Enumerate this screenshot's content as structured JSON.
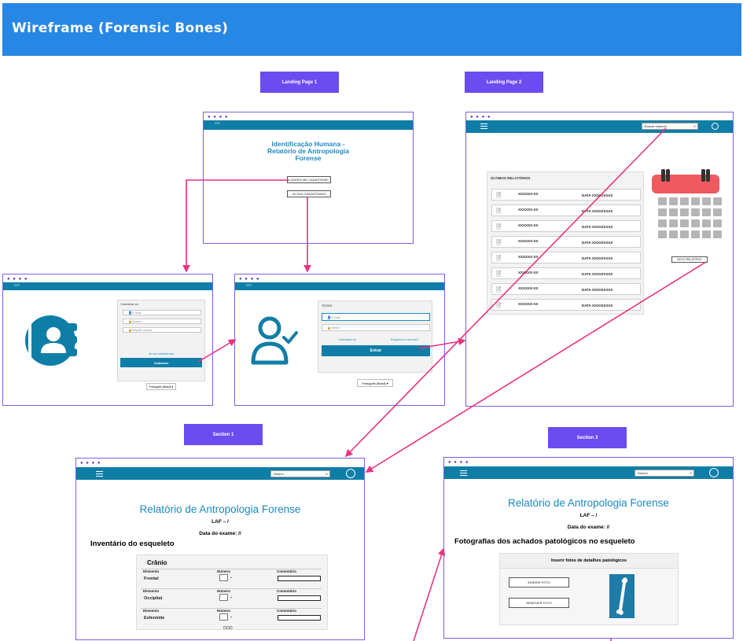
{
  "header": {
    "title": "Wireframe  (Forensic Bones)"
  },
  "tags": {
    "landing1": "Landing Page 1",
    "landing2": "Landing Page 2",
    "section1": "Section 1",
    "section3": "Section 3"
  },
  "landing1": {
    "bar_text": "≡≡≡",
    "title_lines": [
      "Identificação Humana -",
      "Relatório de Antropologia",
      "Forense"
    ],
    "btn_register": "QUERO ME CADASTRAR",
    "btn_login": "JÁ SOU CADASTRADO"
  },
  "register": {
    "bar_text": "≡≡≡",
    "panel_title": "Cadastrar-se",
    "fields": [
      "E-mail",
      "Senha",
      "Repetir senha"
    ],
    "link": "Já sou cadastrado",
    "submit": "Cadastrar",
    "language": "Português (Brasil) ▾"
  },
  "login": {
    "bar_text": "≡≡≡",
    "panel_title": "Entrar",
    "fields": [
      "E-mail",
      "Senha"
    ],
    "link_left": "Cadastrar-se",
    "link_right": "Esqueceu a senha?",
    "submit": "Entrar",
    "language": "Português (Brasil) ▾"
  },
  "landing2": {
    "search_placeholder": "Buscar relatório",
    "reports_title": "ÚLTIMOS RELATÓRIOS",
    "reports": [
      {
        "name": "XXXXXX-XX",
        "date": "DATA XX/XX/XXXX"
      },
      {
        "name": "XXXXXX-XX",
        "date": "DATA XX/XX/XXXX"
      },
      {
        "name": "XXXXXX-XX",
        "date": "DATA XX/XX/XXXX"
      },
      {
        "name": "XXXXXX-XX",
        "date": "DATA XX/XX/XXXX"
      },
      {
        "name": "XXXXXX-XX",
        "date": "DATA XX/XX/XXXX"
      },
      {
        "name": "XXXXXX-XX",
        "date": "DATA XX/XX/XXXX"
      },
      {
        "name": "XXXXXX-XX",
        "date": "DATA XX/XX/XXXX"
      },
      {
        "name": "XXXXXX-XX",
        "date": "DATA XX/XX/XXXX"
      }
    ],
    "new_report_btn": "NOVO RELATÓRIO"
  },
  "section1": {
    "search_placeholder": "Search",
    "title": "Relatório de Antropologia Forense",
    "laf": "LAF –   /",
    "exam_date": "Data do exame: //",
    "subtitle": "Inventário do esqueleto",
    "table_title": "Crânio",
    "col_element": "Elemento",
    "col_number": "Número",
    "col_comment": "Comentário",
    "rows": [
      "Frontal",
      "Occipital",
      "Esfenóide"
    ],
    "more": "OOO"
  },
  "section3": {
    "search_placeholder": "Search",
    "title": "Relatório de Antropologia Forense",
    "laf": "LAF –   /",
    "exam_date": "Data do exame: //",
    "subtitle": "Fotografias dos achados patológicos no esqueleto",
    "panel_title": "Inserir fotos de detalhes patológicos",
    "btn_insert": "INSERIR FOTO",
    "btn_remove": "REMOVER FOTO"
  },
  "colors": {
    "header": "#2787e4",
    "tag": "#6b4cf0",
    "teal": "#0e7ea7",
    "arrow": "#e8337f",
    "calendar_red": "#f05a5f"
  }
}
